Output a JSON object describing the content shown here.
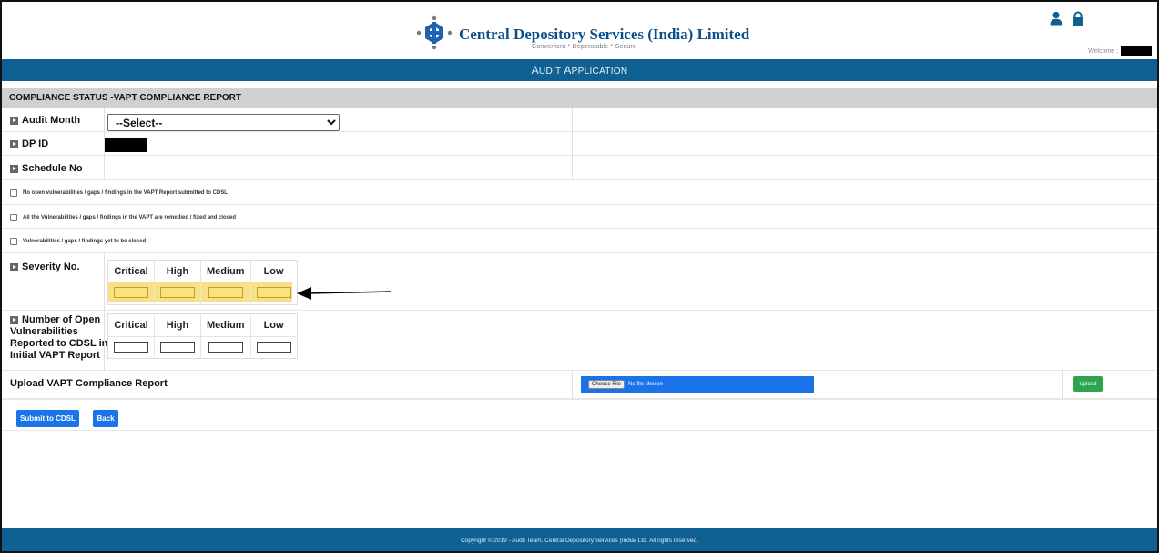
{
  "header": {
    "brand": "Central Depository Services (India) Limited",
    "tagline": "Convenient  *  Dependable  *  Secure",
    "welcome_label": "Welcome :",
    "icons": [
      "user-icon",
      "lock-icon"
    ]
  },
  "appbar": {
    "title_first": "A",
    "title_rest": "UDIT ",
    "title_second_first": "A",
    "title_second_rest": "PPLICATION"
  },
  "section": {
    "title": "COMPLIANCE STATUS -VAPT COMPLIANCE REPORT"
  },
  "form": {
    "audit_month_label": "Audit Month",
    "audit_month_value": "--Select--",
    "dp_id_label": "DP ID",
    "schedule_no_label": "Schedule No",
    "checkboxes": [
      "No open vulnerabilities / gaps / findings in the VAPT Report submitted to CDSL",
      "All the Vulnerabilities / gaps / findings in the VAPT are remedied / fixed and closed",
      "Vulnerabilities / gaps / findings yet to be closed"
    ],
    "severity_label": "Severity No.",
    "open_vuln_label_lines": [
      "Number of Open",
      "Vulnerabilities",
      "Reported to CDSL in",
      "Initial VAPT Report"
    ],
    "severity_columns": [
      "Critical",
      "High",
      "Medium",
      "Low"
    ],
    "upload_label": "Upload VAPT Compliance Report",
    "choose_file_label": "Choose File",
    "no_file_text": "No file chosen",
    "upload_button": "Upload",
    "submit_button": "Submit to CDSL",
    "back_button": "Back"
  },
  "footer": {
    "text": "Copyright © 2019 - Audit Team, Central Depository Services (India) Ltd. All rights reserved."
  },
  "colors": {
    "primary": "#0f6194",
    "accent_blue": "#1a73e8",
    "success": "#2ea44f",
    "highlight": "#f9df86",
    "section_gray": "#d0d0d0"
  }
}
